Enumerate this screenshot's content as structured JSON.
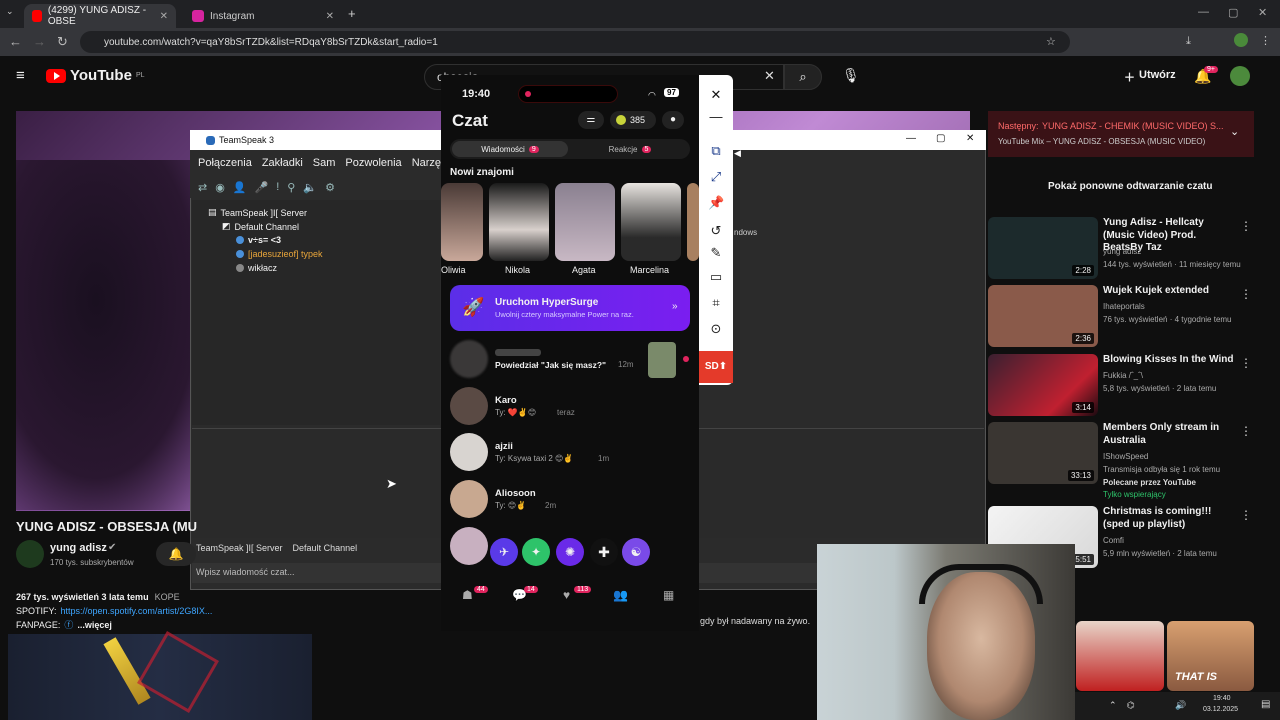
{
  "browser": {
    "tabs": [
      {
        "title": "(4299) YUNG ADISZ - OBSE",
        "favicon_color": "#ff0000"
      },
      {
        "title": "Instagram",
        "favicon_color": "#d6249f"
      }
    ],
    "new_tab": "+",
    "url": "youtube.com/watch?v=qaY8bSrTZDk&list=RDqaY8bSrTZDk&start_radio=1"
  },
  "youtube": {
    "logo": "YouTube",
    "logo_region": "PL",
    "search_value": "obsesja",
    "create_label": "Utwórz",
    "notif_count": "9+"
  },
  "teamspeak": {
    "title": "TeamSpeak 3",
    "menu": [
      "Połączenia",
      "Zakładki",
      "Sam",
      "Pozwolenia",
      "Narzędzia",
      "P"
    ],
    "tree": {
      "server": "TeamSpeak ]I[ Server",
      "channel": "Default Channel",
      "users": [
        "v÷s= <3",
        "[jadesuzieof] typek",
        "wikłacz"
      ]
    },
    "status_server": "TeamSpeak ]I[ Server",
    "status_channel": "Default Channel",
    "input_placeholder": "Wpisz wiadomość czat...",
    "side_text": "ndows"
  },
  "phone": {
    "time": "19:40",
    "battery": "97",
    "title": "Czat",
    "coins": "385",
    "tabs": [
      {
        "label": "Wiadomości",
        "count": "9"
      },
      {
        "label": "Reakcje",
        "count": "5"
      }
    ],
    "new_friends_label": "Nowi znajomi",
    "friends": [
      "Oliwia",
      "Nikola",
      "Agata",
      "Marcelina"
    ],
    "promo": {
      "title": "Uruchom HyperSurge",
      "subtitle": "Uwolnij cztery maksymalne Power na raz."
    },
    "chats": [
      {
        "name": "",
        "msg": "Powiedział \"Jak się masz?\"",
        "time": "12m"
      },
      {
        "name": "Karo",
        "msg": "Ty: ❤️✌️😊",
        "time": "teraz"
      },
      {
        "name": "ajzii",
        "msg": "Ty: Ksywa taxi 2 😊✌️",
        "time": "1m"
      },
      {
        "name": "Aliosoon",
        "msg": "Ty: 😊✌️",
        "time": "2m"
      }
    ],
    "nav_badges": [
      "44",
      "14",
      "113"
    ],
    "sd_label": "SD"
  },
  "sidebar": {
    "up_next_label": "Następny:",
    "up_next_title": "YUNG ADISZ - CHEMIK (MUSIC VIDEO) S...",
    "up_next_sub": "YouTube Mix – YUNG ADISZ - OBSESJA (MUSIC VIDEO)",
    "replay_chat": "Pokaż ponowne odtwarzanie czatu",
    "recs": [
      {
        "title": "Yung Adisz - Hellcaty (Music Video) Prod. BeatsBy Taz",
        "channel": "yung adisz",
        "meta": "144 tys. wyświetleń · 11 miesięcy temu",
        "duration": "2:28",
        "thumb": "#1c2a2c"
      },
      {
        "title": "Wujek Kujek extended",
        "channel": "Ihateportals",
        "meta": "76 tys. wyświetleń · 4 tygodnie temu",
        "duration": "2:36",
        "thumb": "#8a5a4a"
      },
      {
        "title": "Blowing Kisses In the Wind",
        "channel": "Fukkia /ˆ_ˆ\\",
        "meta": "5,8 tys. wyświetleń · 2 lata temu",
        "duration": "3:14",
        "thumb": "#3a2030"
      },
      {
        "title": "Members Only stream in Australia",
        "channel": "IShowSpeed",
        "meta": "Transmisja odbyła się 1 rok temu",
        "extra": "Polecane przez YouTube",
        "extra2": "Tylko wspierający",
        "duration": "33:13",
        "thumb": "#3a3632"
      },
      {
        "title": "Christmas is coming!!!(sped up playlist)",
        "channel": "Comfi",
        "meta": "5,9 mln wyświetleń · 2 lata temu",
        "duration": "15:51",
        "thumb": "#e8e8e8"
      }
    ],
    "bottom_thumb_text": "THAT IS"
  },
  "video": {
    "title": "YUNG ADISZ - OBSESJA (MU",
    "channel": "yung adisz",
    "subs": "170 tys. subskrybentów",
    "views": "267 tys. wyświetleń  3 lata temu",
    "kopen": "KOPE",
    "spotify_label": "SPOTIFY:",
    "spotify_link": "https://open.spotify.com/artist/2G8IX...",
    "fanpage_label": "FANPAGE:",
    "more": "...więcej",
    "live_note": "gdy był nadawany na żywo."
  },
  "taskbar": {
    "time": "19:40",
    "date": "03.12.2025"
  }
}
